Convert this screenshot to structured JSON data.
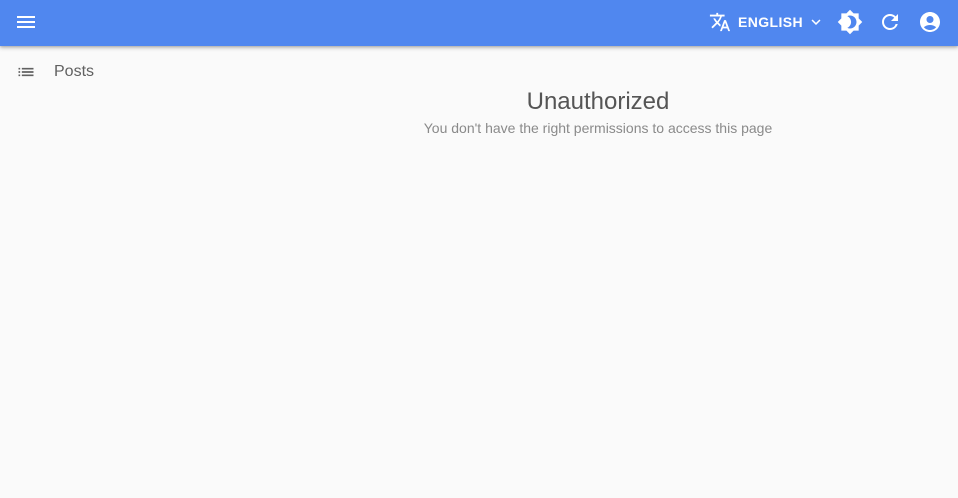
{
  "appbar": {
    "menu_icon": "menu-icon",
    "language": {
      "icon": "translate-icon",
      "label": "ENGLISH",
      "chevron": "chevron-down-icon"
    },
    "theme_icon": "brightness-icon",
    "refresh_icon": "refresh-icon",
    "account_icon": "account-circle-icon",
    "color": "#5087ef"
  },
  "sidebar": {
    "items": [
      {
        "label": "Posts",
        "icon": "list-icon"
      }
    ]
  },
  "main": {
    "title": "Unauthorized",
    "message": "You don't have the right permissions to access this page"
  }
}
